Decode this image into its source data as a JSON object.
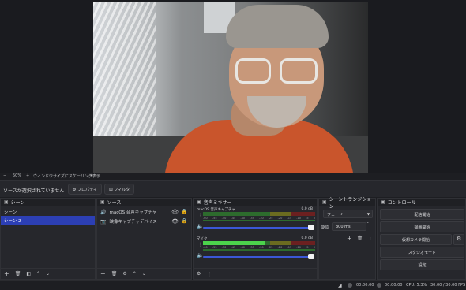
{
  "zoom": {
    "minus": "−",
    "value": "50%",
    "plus": "+",
    "scaling_label": "ウィンドウサイズにスケーリング表示",
    "caret": "▾"
  },
  "context": {
    "no_source": "ソースが選択されていません",
    "properties": "プロパティ",
    "filters": "フィルタ"
  },
  "scenes": {
    "title": "シーン",
    "items": [
      "シーン",
      "シーン 2"
    ],
    "selected_index": 1
  },
  "sources": {
    "title": "ソース",
    "items": [
      {
        "label": "macOS 音声キャプチャ",
        "icon": "speaker-icon"
      },
      {
        "label": "映像キャプチャデバイス",
        "icon": "camera-icon"
      }
    ]
  },
  "mixer": {
    "title": "音声ミキサー",
    "channels": [
      {
        "name": "macOS 音声キャプチャ",
        "db": "0.0 dB",
        "level": 0.0
      },
      {
        "name": "マイク",
        "db": "0.0 dB",
        "level": 0.55
      }
    ],
    "ticks": [
      "-60",
      "-55",
      "-50",
      "-45",
      "-40",
      "-35",
      "-30",
      "-25",
      "-20",
      "-15",
      "-10",
      "-5",
      "0"
    ]
  },
  "transitions": {
    "title": "シーントランジション",
    "selected": "フェード",
    "duration_label": "期間",
    "duration_value": "300 ms"
  },
  "controls": {
    "title": "コントロール",
    "buttons": [
      "配信開始",
      "録画開始",
      "仮想カメラ開始",
      "スタジオモード",
      "設定"
    ]
  },
  "status": {
    "stream_time": "00:00:00",
    "rec_time": "00:00:00",
    "cpu": "CPU: 5.3%",
    "fps": "30.00 / 30.00 FPS"
  },
  "colors": {
    "selected": "#2c3fb4",
    "slider": "#3b57d6",
    "meter_green": "#4cd34c"
  }
}
